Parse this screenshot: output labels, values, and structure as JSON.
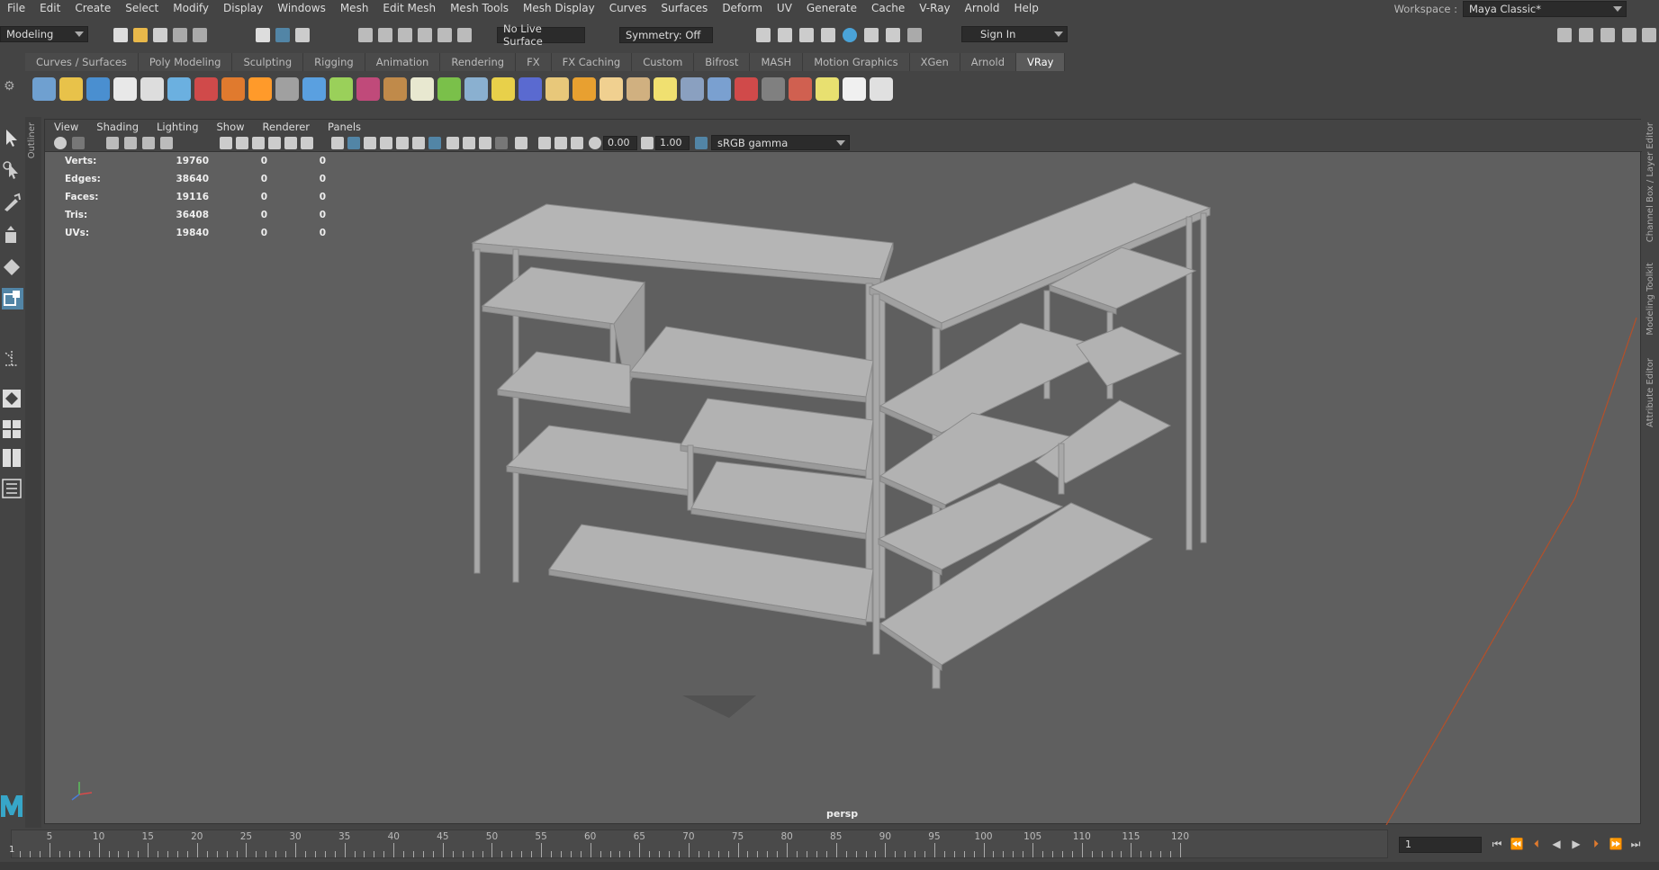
{
  "menu": {
    "items": [
      "File",
      "Edit",
      "Create",
      "Select",
      "Modify",
      "Display",
      "Windows",
      "Mesh",
      "Edit Mesh",
      "Mesh Tools",
      "Mesh Display",
      "Curves",
      "Surfaces",
      "Deform",
      "UV",
      "Generate",
      "Cache",
      "V-Ray",
      "Arnold",
      "Help"
    ]
  },
  "workspace": {
    "label": "Workspace :",
    "value": "Maya Classic*"
  },
  "statusline": {
    "mode": "Modeling",
    "live_surface": "No Live Surface",
    "symmetry": "Symmetry: Off",
    "sign_in": "Sign In"
  },
  "shelf": {
    "tabs": [
      "Curves / Surfaces",
      "Poly Modeling",
      "Sculpting",
      "Rigging",
      "Animation",
      "Rendering",
      "FX",
      "FX Caching",
      "Custom",
      "Bifrost",
      "MASH",
      "Motion Graphics",
      "XGen",
      "Arnold",
      "VRay"
    ],
    "active_tab": "VRay"
  },
  "viewport": {
    "panel_menu": [
      "View",
      "Shading",
      "Lighting",
      "Show",
      "Renderer",
      "Panels"
    ],
    "exposure": "0.00",
    "gamma": "1.00",
    "color_space": "sRGB gamma",
    "camera": "persp",
    "hud": [
      {
        "label": "Verts:",
        "a": "19760",
        "b": "0",
        "c": "0"
      },
      {
        "label": "Edges:",
        "a": "38640",
        "b": "0",
        "c": "0"
      },
      {
        "label": "Faces:",
        "a": "19116",
        "b": "0",
        "c": "0"
      },
      {
        "label": "Tris:",
        "a": "36408",
        "b": "0",
        "c": "0"
      },
      {
        "label": "UVs:",
        "a": "19840",
        "b": "0",
        "c": "0"
      }
    ]
  },
  "side_panels": {
    "outliner": "Outliner",
    "channel_box": "Channel Box / Layer Editor",
    "modeling_toolkit": "Modeling Toolkit",
    "attribute_editor": "Attribute Editor"
  },
  "timeline": {
    "ticks": [
      "5",
      "10",
      "15",
      "20",
      "25",
      "30",
      "35",
      "40",
      "45",
      "50",
      "55",
      "60",
      "65",
      "70",
      "75",
      "80",
      "85",
      "90",
      "95",
      "100",
      "105",
      "110",
      "115",
      "120"
    ],
    "current_frame": "1",
    "start_label": "1"
  },
  "colors": {
    "ui_bg": "#444444",
    "viewport_bg": "#5f5f5f",
    "model_gray": "#b2b2b2",
    "accent_blue": "#5285a6",
    "guide_line": "#b4502a"
  }
}
